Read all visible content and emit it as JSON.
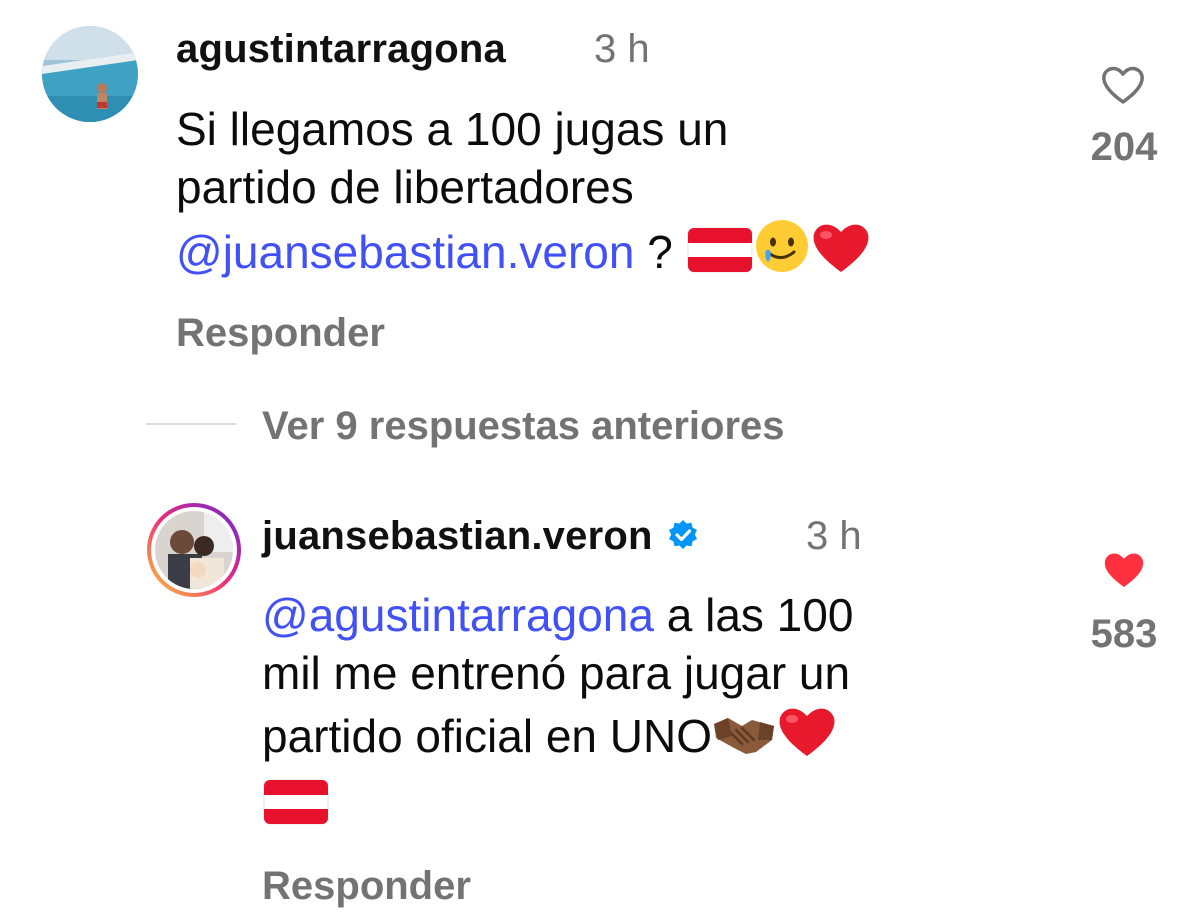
{
  "comments": [
    {
      "username": "agustintarragona",
      "time": "3 h",
      "text_line1": "Si llegamos a 100 jugas un",
      "text_line2": "partido de libertadores",
      "mention": "juansebastian.veron",
      "mention_suffix": " ? ",
      "reply_label": "Responder",
      "like_count": "204",
      "liked": false
    },
    {
      "username": "juansebastian.veron",
      "verified": true,
      "time": "3 h",
      "mention": "agustintarragona",
      "text_after_mention": " a las 100",
      "text_line2": "mil me entrenó para jugar un",
      "text_line3": "partido oficial en UNO",
      "reply_label": "Responder",
      "like_count": "583",
      "liked": true
    }
  ],
  "view_more_label": "Ver 9 respuestas anteriores",
  "colors": {
    "mention": "#4150f7",
    "secondary_text": "#737373",
    "like_red": "#ff3040",
    "verified_blue": "#0095f6"
  },
  "icons": {
    "like_outline": "heart-outline-icon",
    "like_filled": "heart-filled-icon",
    "verified": "verified-badge-icon",
    "threads_at": "threads-at-icon"
  }
}
